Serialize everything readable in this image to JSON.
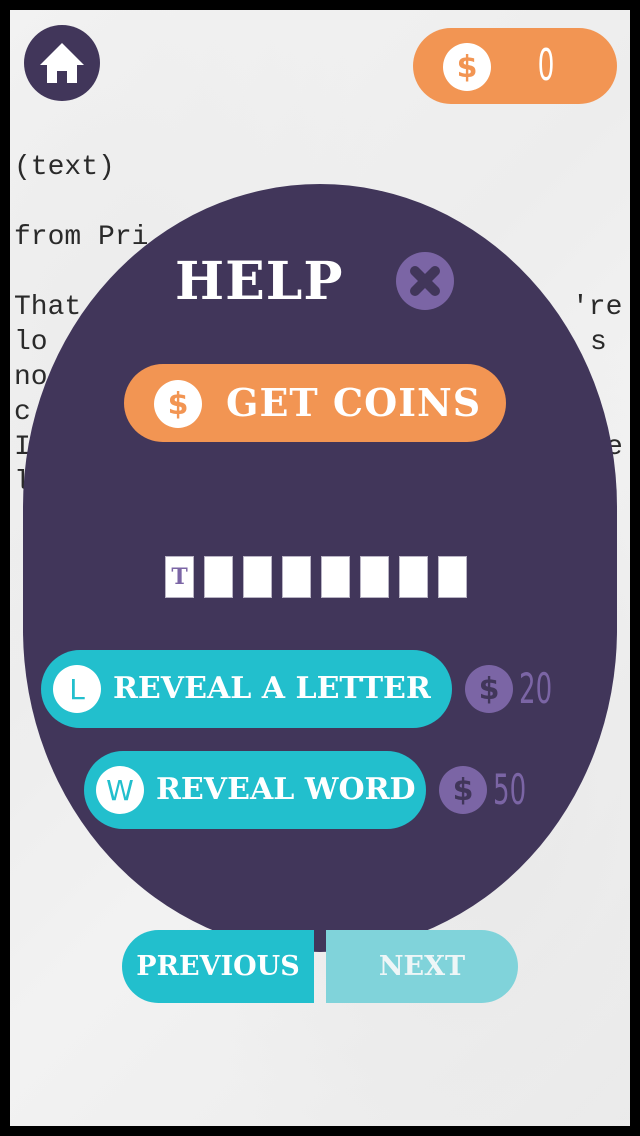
{
  "header": {
    "home_icon": "home-icon",
    "coin_icon": "dollar-coin-icon",
    "coin_balance": "0"
  },
  "background_text": {
    "lines": [
      {
        "left": "(text)",
        "right": ""
      },
      {
        "left": "from Pri",
        "right": ""
      },
      {
        "left": "That",
        "right": "'re"
      },
      {
        "left": "lo",
        "right": "s"
      },
      {
        "left": "no",
        "right": ""
      },
      {
        "left": "c",
        "right": ""
      },
      {
        "left": "I",
        "right": "e"
      },
      {
        "left": "l",
        "right": ""
      }
    ]
  },
  "help_dialog": {
    "title": "HELP",
    "close_icon": "close-x-icon",
    "get_coins": {
      "icon": "dollar-coin-icon",
      "coin_symbol": "$",
      "label": "GET COINS"
    },
    "word_slots": [
      "T",
      "",
      "",
      "",
      "",
      "",
      "",
      ""
    ],
    "reveal_letter": {
      "badge": "L",
      "label": "REVEAL A LETTER",
      "cost_symbol": "$",
      "cost": "20"
    },
    "reveal_word": {
      "badge": "W",
      "label": "REVEAL WORD",
      "cost_symbol": "$",
      "cost": "50"
    }
  },
  "navigation": {
    "previous_label": "PREVIOUS",
    "next_label": "NEXT"
  },
  "colors": {
    "panel": "#41365a",
    "accent_orange": "#f29553",
    "accent_teal": "#22bfcd",
    "accent_purple": "#7b65a5",
    "next_disabled": "#80d3da"
  }
}
